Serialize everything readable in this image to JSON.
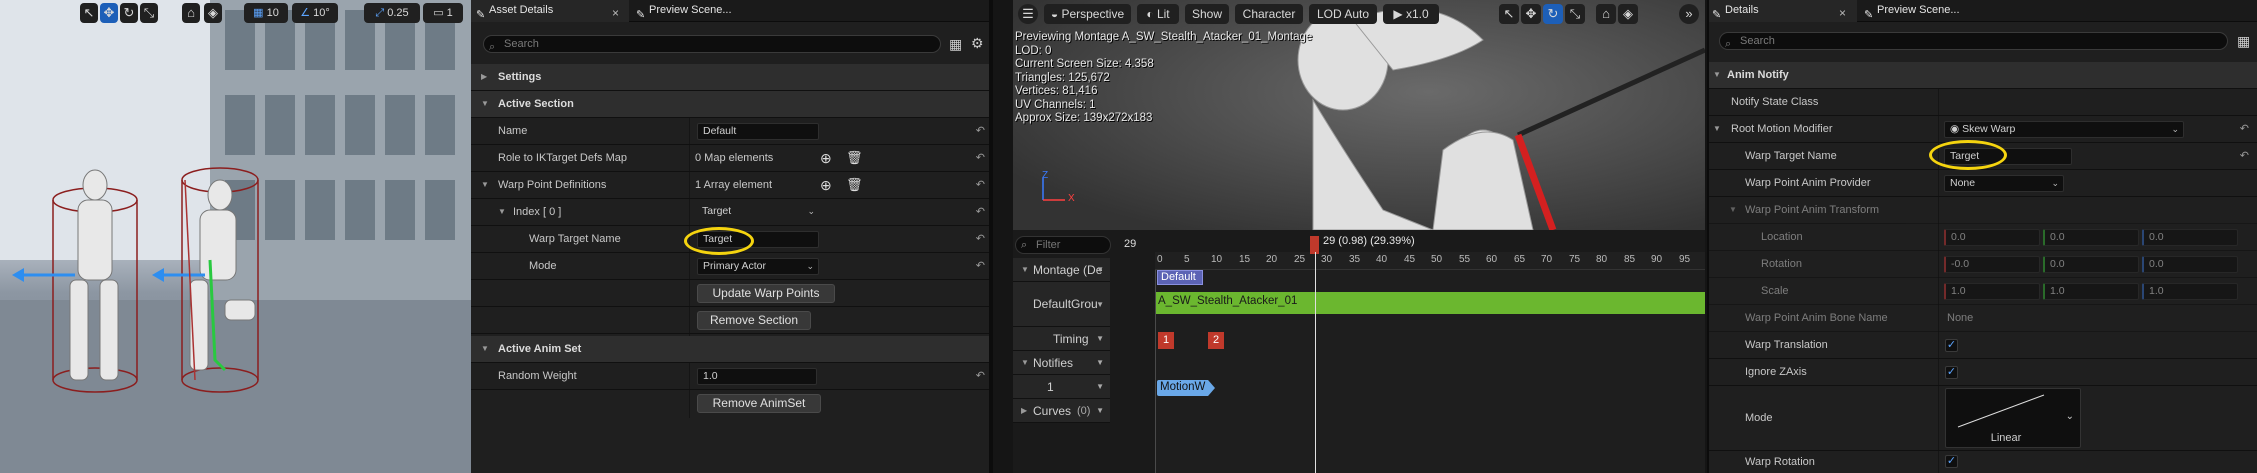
{
  "viewport_left": {
    "toolbar": {
      "grid_value": "10",
      "angle_value": "10°",
      "scale_value": "0.25",
      "camera_speed": "1"
    }
  },
  "asset_details": {
    "tabs": [
      {
        "label": "Asset Details"
      },
      {
        "label": "Preview Scene..."
      }
    ],
    "search_placeholder": "Search",
    "settings_label": "Settings",
    "active_section": {
      "header": "Active Section",
      "name_label": "Name",
      "name_value": "Default",
      "role_label": "Role to IKTarget Defs Map",
      "role_value": "0 Map elements",
      "warp_defs_label": "Warp Point Definitions",
      "warp_defs_value": "1 Array element",
      "index_label": "Index [ 0 ]",
      "index_value": "Target",
      "warp_target_label": "Warp Target Name",
      "warp_target_value": "Target",
      "mode_label": "Mode",
      "mode_value": "Primary Actor",
      "update_button": "Update Warp Points",
      "remove_section_button": "Remove Section"
    },
    "active_anim_set": {
      "header": "Active Anim Set",
      "random_weight_label": "Random Weight",
      "random_weight_value": "1.0",
      "remove_animset_button": "Remove AnimSet"
    }
  },
  "preview": {
    "toolbar": {
      "perspective": "Perspective",
      "lit": "Lit",
      "show": "Show",
      "character": "Character",
      "lod": "LOD Auto",
      "play_speed": "x1.0"
    },
    "stats": [
      "Previewing Montage A_SW_Stealth_Atacker_01_Montage",
      "LOD: 0",
      "Current Screen Size: 4.358",
      "Triangles: 125,672",
      "Vertices: 81,416",
      "UV Channels: 1",
      "Approx Size: 139x272x183"
    ],
    "axis_z": "Z",
    "axis_x": "X"
  },
  "timeline": {
    "filter_placeholder": "Filter",
    "frame_count": "29",
    "playhead_label": "29 (0.98) (29.39%)",
    "ticks": [
      "0",
      "5",
      "10",
      "15",
      "20",
      "25",
      "30",
      "35",
      "40",
      "45",
      "50",
      "55",
      "60",
      "65",
      "70",
      "75",
      "80",
      "85",
      "90",
      "95"
    ],
    "tracks": {
      "montage": "Montage (De",
      "default_group": "DefaultGrou",
      "timing": "Timing",
      "notifies": "Notifies",
      "notify_track": "1",
      "curves": "Curves",
      "curves_count": "(0)"
    },
    "default_section": "Default",
    "anim_segment": "A_SW_Stealth_Atacker_01",
    "timing_markers": [
      "1",
      "2"
    ],
    "notify_name": "MotionW"
  },
  "details": {
    "tabs": [
      {
        "label": "Details"
      },
      {
        "label": "Preview Scene..."
      }
    ],
    "search_placeholder": "Search",
    "anim_notify_header": "Anim Notify",
    "notify_state_class_label": "Notify State Class",
    "root_motion_label": "Root Motion Modifier",
    "root_motion_value": "Skew Warp",
    "warp_target_label": "Warp Target Name",
    "warp_target_value": "Target",
    "warp_provider_label": "Warp Point Anim Provider",
    "warp_provider_value": "None",
    "warp_transform_label": "Warp Point Anim Transform",
    "location_label": "Location",
    "location_values": [
      "0.0",
      "0.0",
      "0.0"
    ],
    "rotation_label": "Rotation",
    "rotation_values": [
      "-0.0",
      "0.0",
      "0.0"
    ],
    "scale_label": "Scale",
    "scale_values": [
      "1.0",
      "1.0",
      "1.0"
    ],
    "bone_name_label": "Warp Point Anim Bone Name",
    "bone_name_value": "None",
    "warp_translation_label": "Warp Translation",
    "ignore_z_label": "Ignore ZAxis",
    "mode_label": "Mode",
    "mode_value": "Linear",
    "warp_rotation_label": "Warp Rotation"
  },
  "colors": {
    "highlight": "#f5d40f",
    "anim_segment": "#6bb72f",
    "timing_marker": "#c0392b",
    "notify": "#6aa8e8",
    "checkbox": "#5da5ff"
  }
}
